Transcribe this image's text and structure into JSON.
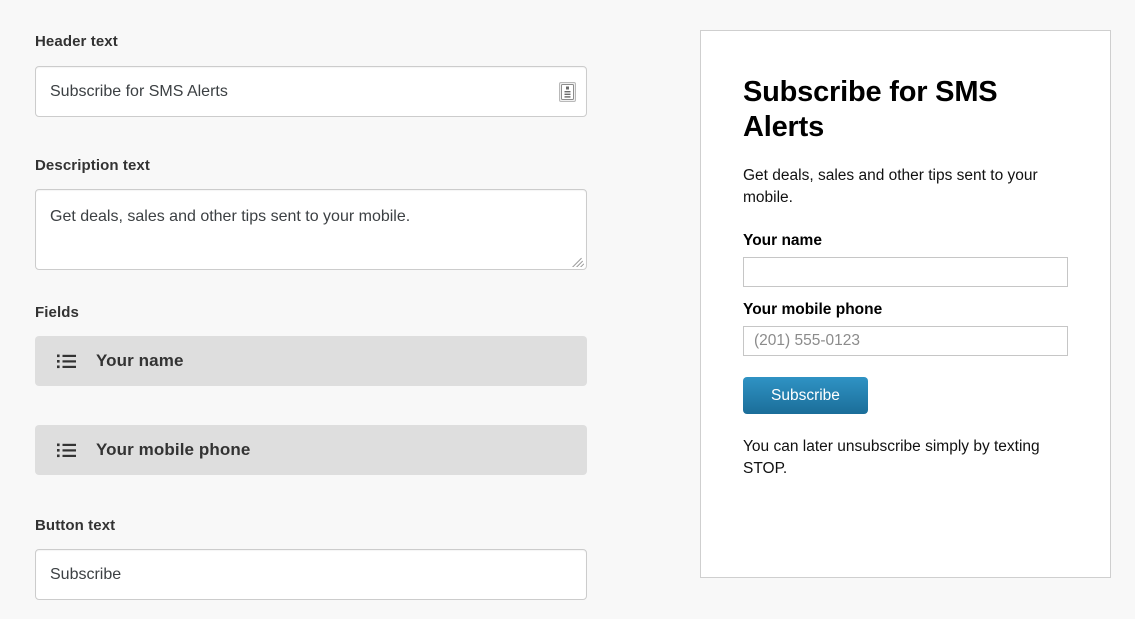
{
  "editor": {
    "header_field": {
      "label": "Header text",
      "value": "Subscribe for SMS Alerts",
      "insert_icon": "merge-tag-icon"
    },
    "description_field": {
      "label": "Description text",
      "value": "Get deals, sales and other tips sent to your mobile."
    },
    "fields_section": {
      "label": "Fields",
      "rows": [
        {
          "label": "Your name",
          "icon": "list-drag-icon"
        },
        {
          "label": "Your mobile phone",
          "icon": "list-drag-icon"
        }
      ]
    },
    "button_field": {
      "label": "Button text",
      "value": "Subscribe"
    }
  },
  "preview": {
    "title": "Subscribe for SMS Alerts",
    "description": "Get deals, sales and other tips sent to your mobile.",
    "name_label": "Your name",
    "name_value": "",
    "name_placeholder": "",
    "phone_label": "Your mobile phone",
    "phone_value": "",
    "phone_placeholder": "(201) 555-0123",
    "submit_label": "Subscribe",
    "footnote": "You can later unsubscribe simply by texting STOP."
  },
  "colors": {
    "page_background": "#f8f8f8",
    "panel_background": "#ffffff",
    "panel_border": "#cfcfcf",
    "field_row_background": "#dedede",
    "input_border": "#cccccc",
    "button_gradient_top": "#2f93c4",
    "button_gradient_bottom": "#1b6e99",
    "text_primary": "#333333",
    "placeholder": "#8b8b8b"
  }
}
